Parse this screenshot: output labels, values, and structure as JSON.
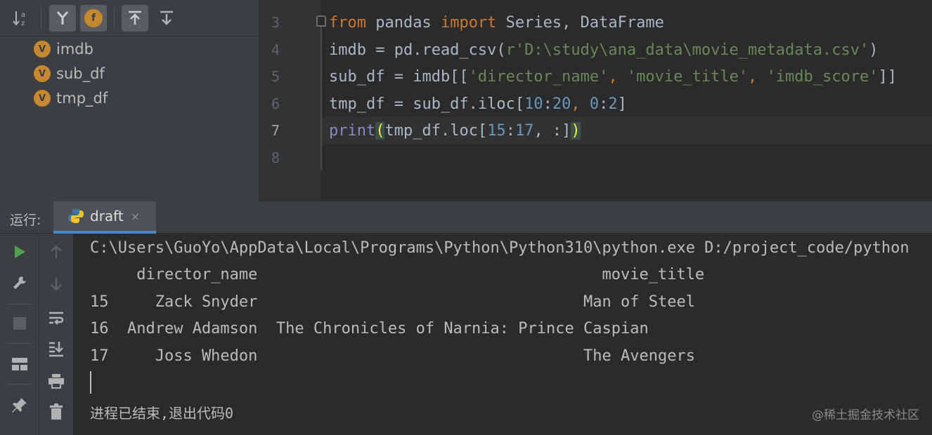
{
  "structure": {
    "items": [
      {
        "badge": "V",
        "label": "imdb"
      },
      {
        "badge": "V",
        "label": "sub_df"
      },
      {
        "badge": "V",
        "label": "tmp_df"
      }
    ],
    "toolbar": {
      "sort_icon": "sort-alpha-icon",
      "fields_icon": "show-fields-icon",
      "functions_badge": "f",
      "expand_icon": "expand-all-icon",
      "collapse_icon": "collapse-all-icon"
    }
  },
  "editor": {
    "line_numbers": [
      "3",
      "4",
      "5",
      "6",
      "7",
      "8"
    ],
    "current_line": "7",
    "line3": {
      "kw1": "from",
      "mod": " pandas ",
      "kw2": "import",
      "rest": " Series, DataFrame"
    },
    "line4": {
      "a": "imdb = pd.read_csv(",
      "s": "r'D:\\study\\ana_data\\movie_metadata.csv'",
      "b": ")"
    },
    "line5": {
      "a": "sub_df = imdb[[",
      "s1": "'director_name'",
      "c1": ", ",
      "s2": "'movie_title'",
      "c2": ", ",
      "s3": "'imdb_score'",
      "b": "]]"
    },
    "line6": {
      "a": "tmp_df = sub_df.iloc[",
      "n1": "10",
      "c1": ":",
      "n2": "20",
      "c2": ", ",
      "n3": "0",
      "c3": ":",
      "n4": "2",
      "b": "]"
    },
    "line7": {
      "fn": "print",
      "p1": "(",
      "a": "tmp_df.loc[",
      "n1": "15",
      "c1": ":",
      "n2": "17",
      "c2": ", :]",
      "p2": ")"
    }
  },
  "run": {
    "label": "运行:",
    "tab_label": "draft",
    "tab_close": "×"
  },
  "console": {
    "command": "C:\\Users\\GuoYo\\AppData\\Local\\Programs\\Python\\Python310\\python.exe D:/project_code/python",
    "header": "     director_name                                     movie_title",
    "rows": [
      "15     Zack Snyder                                   Man of Steel",
      "16  Andrew Adamson  The Chronicles of Narnia: Prince Caspian",
      "17     Joss Whedon                                   The Avengers"
    ],
    "exit_message": "进程已结束,退出代码0",
    "watermark": "@稀土掘金技术社区"
  },
  "colors": {
    "keyword": "#cc7832",
    "string": "#6a8759",
    "number": "#6897bb",
    "builtin": "#8888c6",
    "run_green": "#4fa34f",
    "tab_underline": "#4a88c7"
  }
}
